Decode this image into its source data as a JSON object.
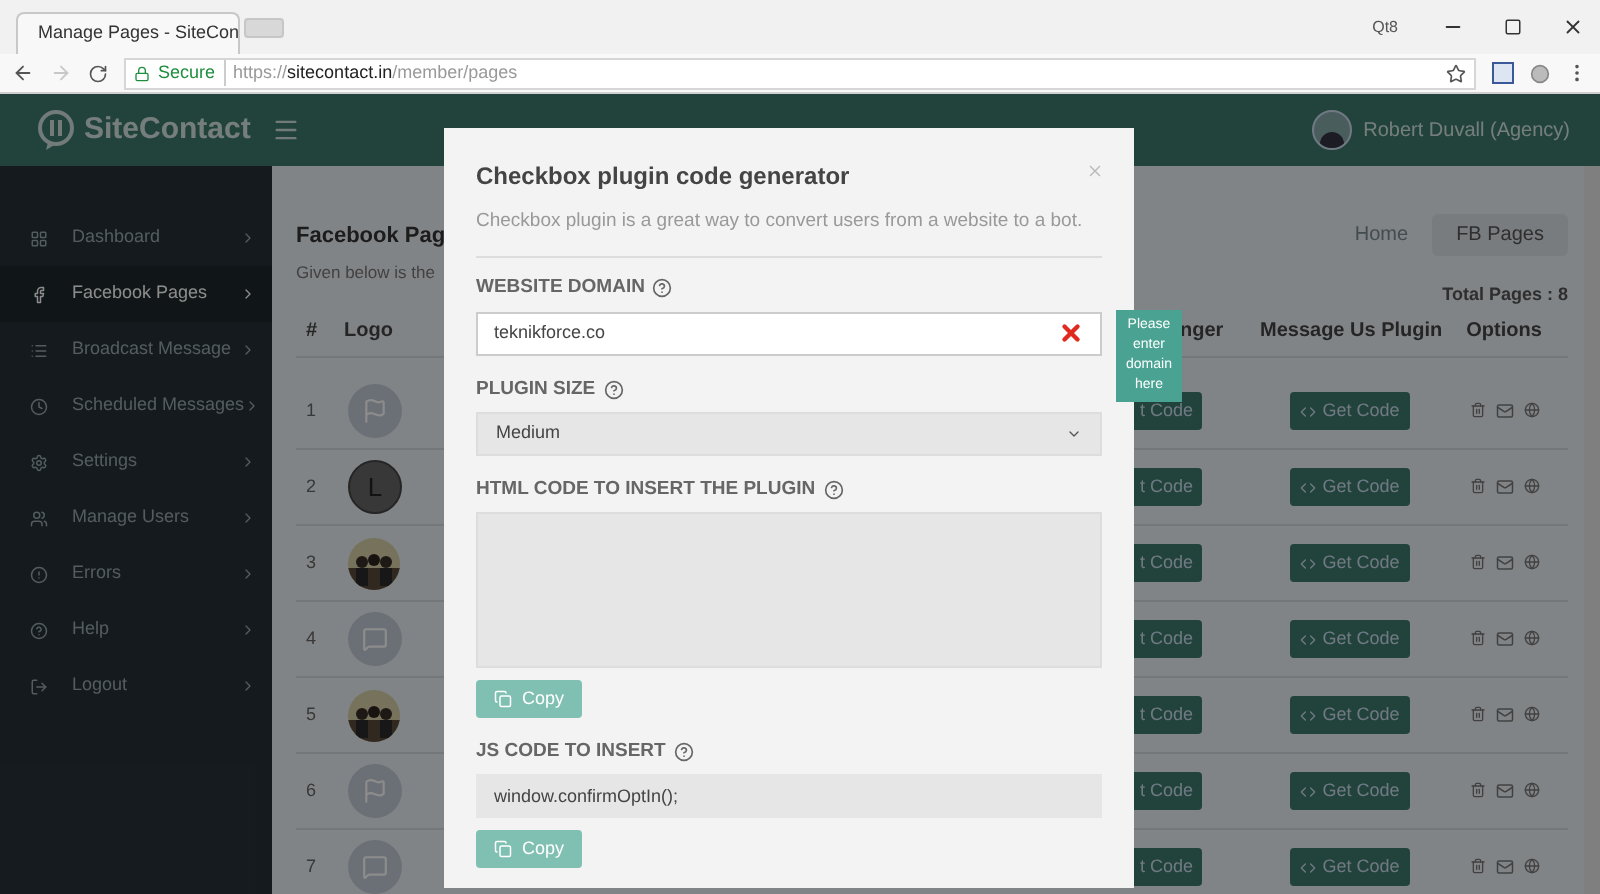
{
  "browser": {
    "tab_title": "Manage Pages - SiteCon",
    "secure_label": "Secure",
    "url": "https://**sitecontact.in**/member/pages",
    "profile": "Qt8"
  },
  "header": {
    "brand": "SiteContact",
    "user": "Robert Duvall (Agency)"
  },
  "sidebar": {
    "items": [
      {
        "label": "Dashboard",
        "selected": false
      },
      {
        "label": "Facebook Pages",
        "selected": true
      },
      {
        "label": "Broadcast Message",
        "selected": false
      },
      {
        "label": "Scheduled Messages",
        "selected": false
      },
      {
        "label": "Settings",
        "selected": false
      },
      {
        "label": "Manage Users",
        "selected": false
      },
      {
        "label": "Errors",
        "selected": false
      },
      {
        "label": "Help",
        "selected": false
      },
      {
        "label": "Logout",
        "selected": false
      }
    ]
  },
  "page": {
    "title": "Facebook Pag",
    "subtitle": "Given below is the",
    "breadcrumbs": [
      {
        "label": "Home",
        "selected": false
      },
      {
        "label": "FB Pages",
        "selected": true
      }
    ],
    "total": "Total Pages : 8",
    "columns": [
      "#",
      "Logo",
      "nger",
      "Message Us Plugin",
      "Options"
    ],
    "rows": [
      {
        "number": "1",
        "logo": {
          "kind": "flag"
        },
        "messenger_button": "t Code",
        "plugin_button": "Get Code"
      },
      {
        "number": "2",
        "logo": {
          "kind": "letter",
          "letter": "L"
        },
        "messenger_button": "t Code",
        "plugin_button": "Get Code"
      },
      {
        "number": "3",
        "messenger_button": "t Code",
        "plugin_button": "Get Code"
      },
      {
        "number": "4",
        "logo": {
          "kind": "chat"
        },
        "messenger_button": "t Code",
        "plugin_button": "Get Code"
      },
      {
        "number": "5",
        "messenger_button": "t Code",
        "plugin_button": "Get Code"
      },
      {
        "number": "6",
        "logo": {
          "kind": "flag"
        },
        "messenger_button": "t Code",
        "plugin_button": "Get Code"
      },
      {
        "number": "7",
        "logo": {
          "kind": "chat"
        },
        "messenger_button": "t Code",
        "plugin_button": "Get Code"
      }
    ]
  },
  "modal": {
    "title": "Checkbox plugin code generator",
    "description": "Checkbox plugin is a great way to convert users from a website to a bot.",
    "fields": [
      {
        "kind": "input",
        "label": "WEBSITE DOMAIN",
        "value": "teknikforce.co",
        "invalid": true,
        "tooltip": "Please enter domain here"
      },
      {
        "kind": "select",
        "label": "PLUGIN SIZE",
        "value": "Medium"
      },
      {
        "kind": "textarea",
        "label": "HTML CODE TO INSERT THE PLUGIN",
        "copy": "Copy"
      },
      {
        "kind": "input",
        "label": "JS CODE TO INSERT",
        "value": "window.confirmOptIn();",
        "invalid": false,
        "copy": "Copy"
      }
    ]
  }
}
